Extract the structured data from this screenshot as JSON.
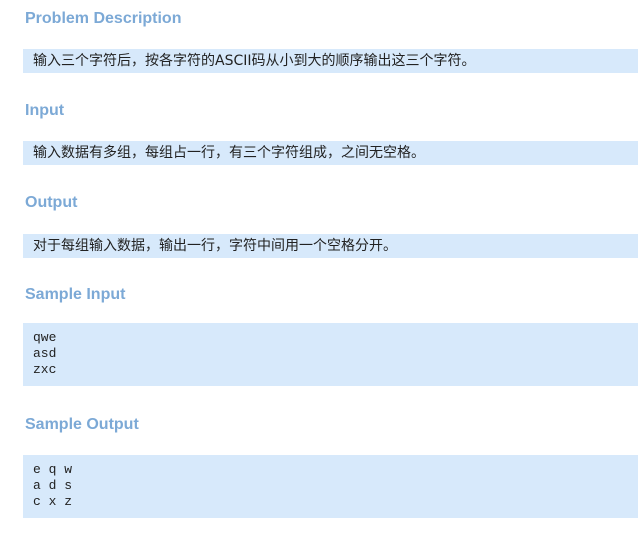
{
  "problem": {
    "description": {
      "title": "Problem Description",
      "text": "输入三个字符后，按各字符的ASCII码从小到大的顺序输出这三个字符。"
    },
    "input": {
      "title": "Input",
      "text": "输入数据有多组，每组占一行，有三个字符组成，之间无空格。"
    },
    "output": {
      "title": "Output",
      "text": "对于每组输入数据，输出一行，字符中间用一个空格分开。"
    },
    "sample_input": {
      "title": "Sample Input",
      "lines": [
        "qwe",
        "asd",
        "zxc"
      ]
    },
    "sample_output": {
      "title": "Sample Output",
      "lines": [
        "e q w",
        "a d s",
        "c x z"
      ]
    }
  }
}
